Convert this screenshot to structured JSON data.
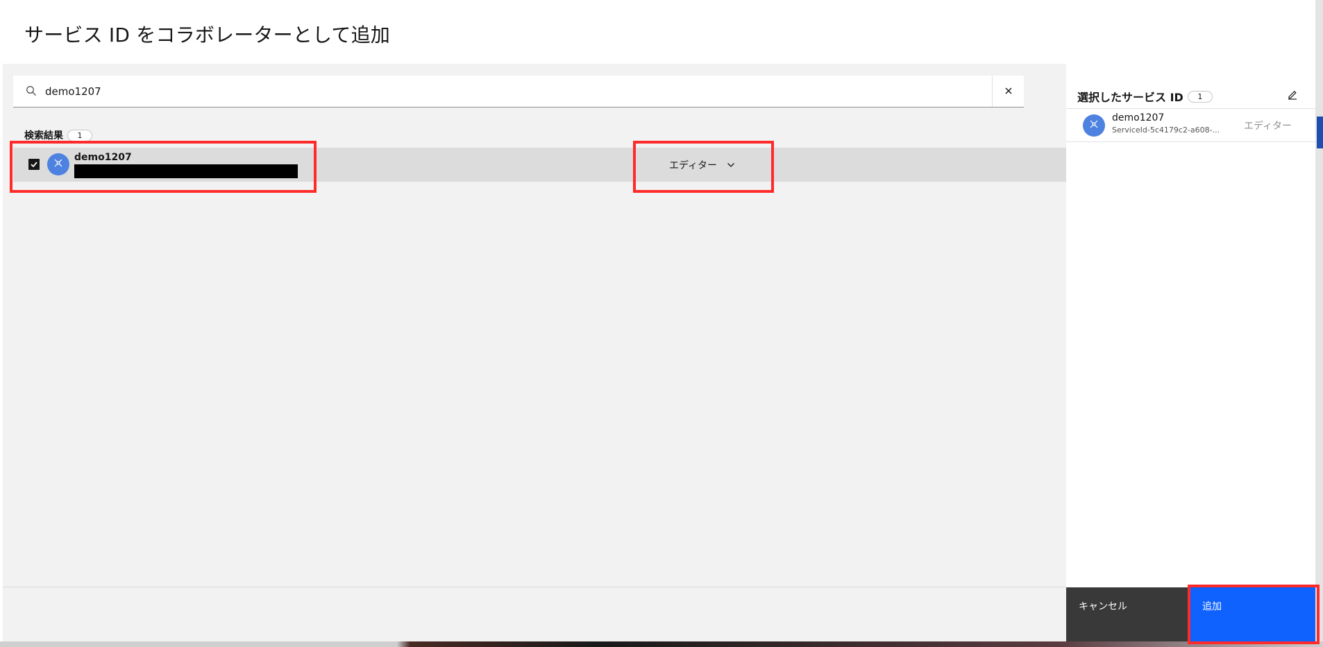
{
  "modal": {
    "title": "サービス ID をコラボレーターとして追加"
  },
  "search": {
    "value": "demo1207",
    "placeholder": ""
  },
  "results": {
    "label": "検索結果",
    "count": "1",
    "items": [
      {
        "name": "demo1207",
        "checked": true,
        "role": "エディター"
      }
    ]
  },
  "selected_panel": {
    "title": "選択したサービス ID",
    "count": "1",
    "items": [
      {
        "name": "demo1207",
        "id": "ServiceId-5c4179c2-a608-...",
        "role": "エディター"
      }
    ]
  },
  "footer": {
    "cancel_label": "キャンセル",
    "add_label": "追加"
  },
  "icons": {
    "search": "search-icon",
    "clear": "close-icon",
    "edit": "edit-icon",
    "service_id": "service-id-icon",
    "dropdown": "chevron-down-icon",
    "checkbox": "checkmark-icon"
  },
  "colors": {
    "primary": "#0f62fe",
    "secondary": "#393939",
    "avatar": "#4d82e0",
    "highlight": "#ff2a2a"
  }
}
